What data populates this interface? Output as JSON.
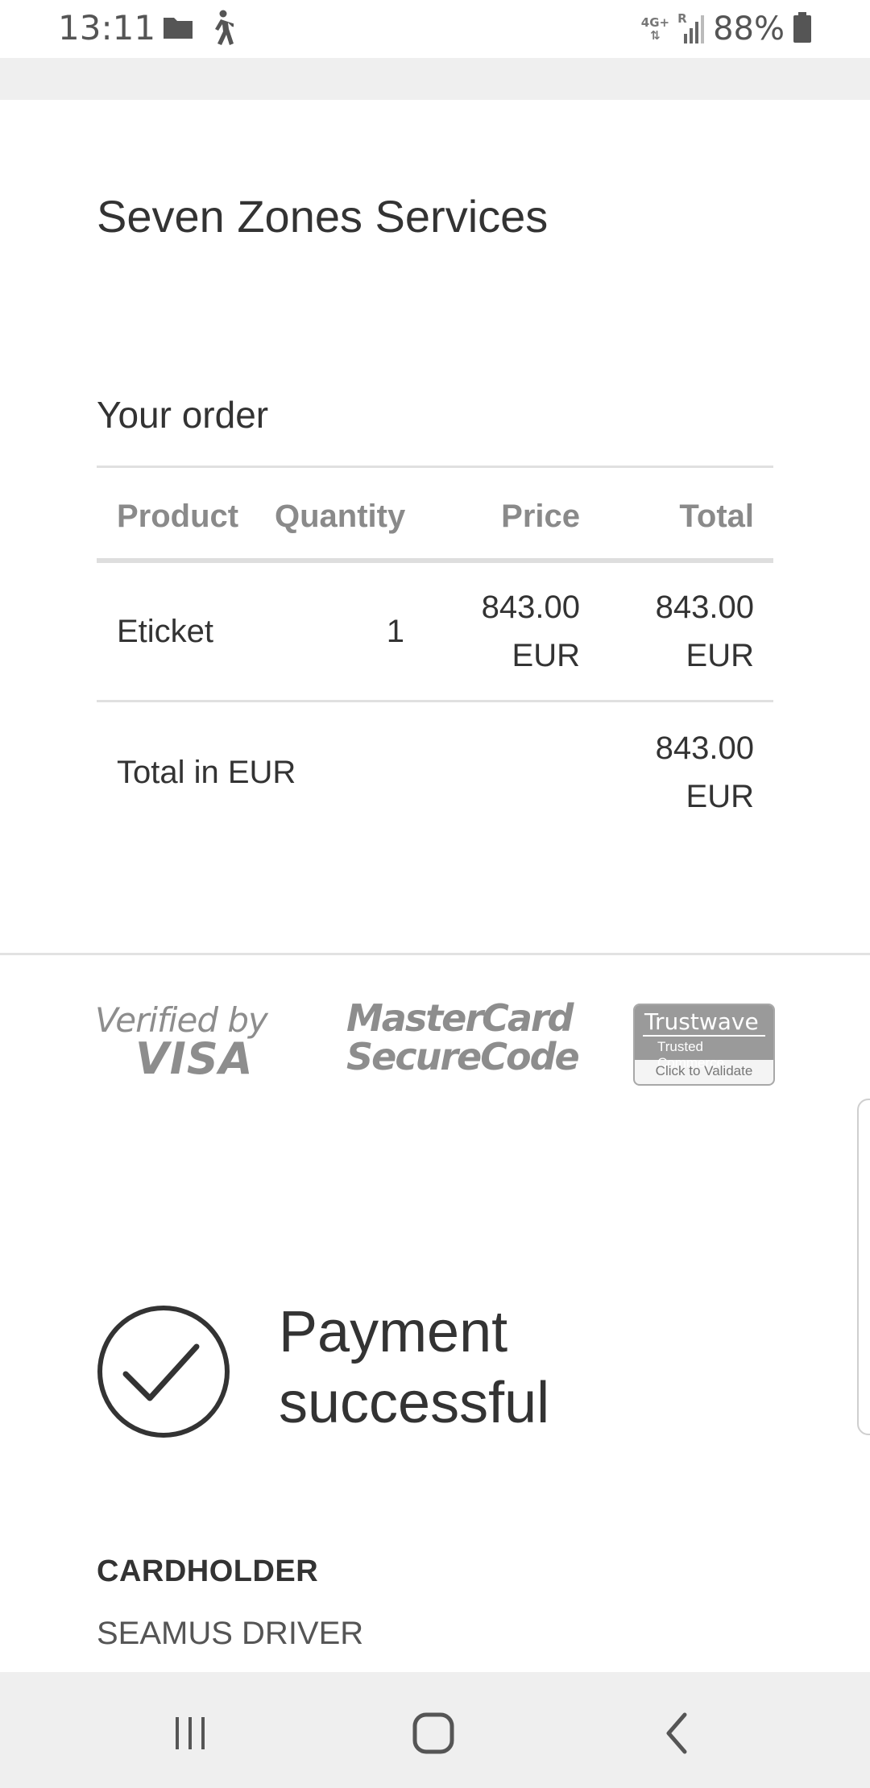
{
  "status_bar": {
    "time": "13:11",
    "network": "4G+",
    "roaming": "R",
    "battery": "88%",
    "icons": [
      "folder-icon",
      "walking-icon",
      "network-data-icon",
      "signal-icon",
      "battery-icon"
    ]
  },
  "merchant": {
    "name": "Seven Zones Services"
  },
  "order": {
    "title": "Your order",
    "columns": {
      "product": "Product",
      "quantity": "Quantity",
      "price": "Price",
      "total": "Total"
    },
    "items": [
      {
        "product": "Eticket",
        "quantity": "1",
        "price_amount": "843.00",
        "price_currency": "EUR",
        "total_amount": "843.00",
        "total_currency": "EUR"
      }
    ],
    "total": {
      "label": "Total in EUR",
      "amount": "843.00",
      "currency": "EUR"
    }
  },
  "security_logos": {
    "visa_line1": "Verified by",
    "visa_line2": "VISA",
    "mastercard_line1": "MasterCard",
    "mastercard_line2": "SecureCode",
    "trustwave_brand": "Trustwave",
    "trustwave_sub": "Trusted Commerce",
    "trustwave_cta": "Click to Validate"
  },
  "payment": {
    "status_line1": "Payment",
    "status_line2": "successful"
  },
  "cardholder": {
    "label": "CARDHOLDER",
    "name": "SEAMUS DRIVER"
  },
  "colors": {
    "text": "#333333",
    "muted": "#8a8a8a",
    "band": "#efefef"
  }
}
